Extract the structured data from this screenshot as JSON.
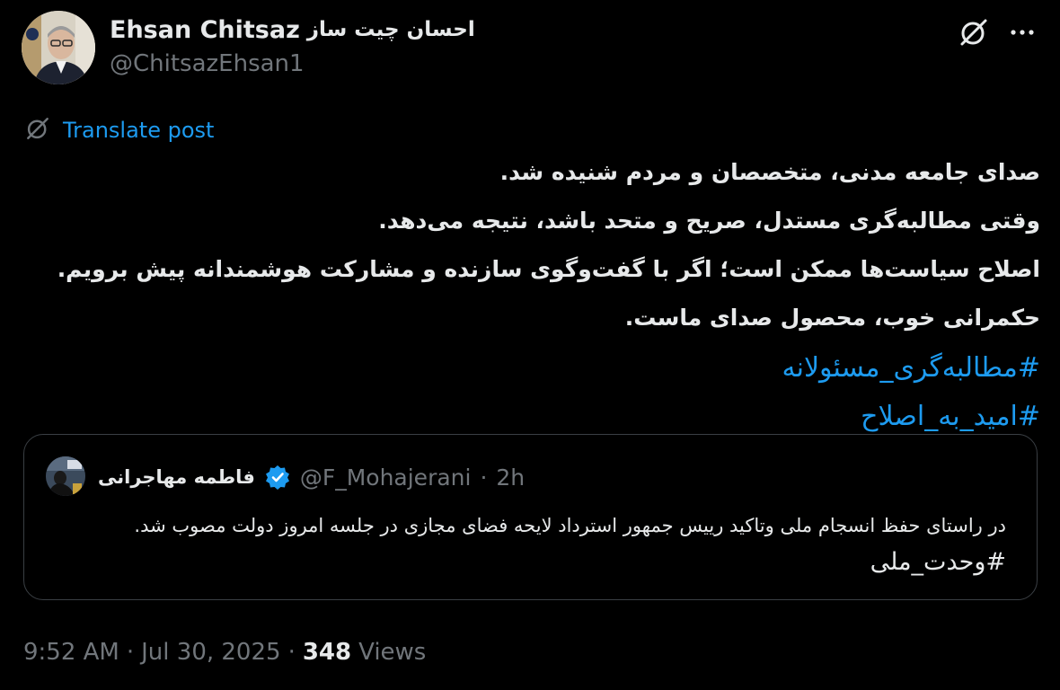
{
  "author": {
    "name": "Ehsan Chitsaz",
    "name_fa": "احسان چیت ساز",
    "handle": "@ChitsazEhsan1"
  },
  "icons": {
    "grok": "grok-slash-icon",
    "more": "more-dots-icon",
    "translate": "grok-slash-icon",
    "verified": "verified-badge-icon"
  },
  "translate": {
    "label": "Translate post"
  },
  "post": {
    "lines": [
      "صدای جامعه مدنی، متخصصان و مردم شنیده شد.",
      "وقتی مطالبه‌گری مستدل، صریح و متحد باشد، نتیجه می‌دهد.",
      "اصلاح سیاست‌ها ممکن است؛ اگر با گفت‌وگوی سازنده و مشارکت هوشمندانه پیش برویم.",
      "حکمرانی خوب، محصول صدای ماست."
    ],
    "hashtags": [
      "#مطالبه‌گری_مسئولانه",
      "#امید_به_اصلاح"
    ]
  },
  "quote": {
    "name": "فاطمه مهاجرانی",
    "handle": "@F_Mohajerani",
    "separator": "·",
    "time": "2h",
    "text": "در راستای حفظ انسجام ملی وتاکید رییس جمهور استرداد لایحه فضای مجازی در جلسه امروز دولت مصوب شد.",
    "hashtag": "#وحدت_ملی"
  },
  "meta": {
    "time": "9:52 AM",
    "separator": "·",
    "date": "Jul 30, 2025",
    "views_count": "348",
    "views_label": "Views"
  },
  "colors": {
    "background": "#000000",
    "text": "#e7e9ea",
    "secondary": "#71767b",
    "accent": "#1d9bf0",
    "border": "#3a3f44"
  }
}
